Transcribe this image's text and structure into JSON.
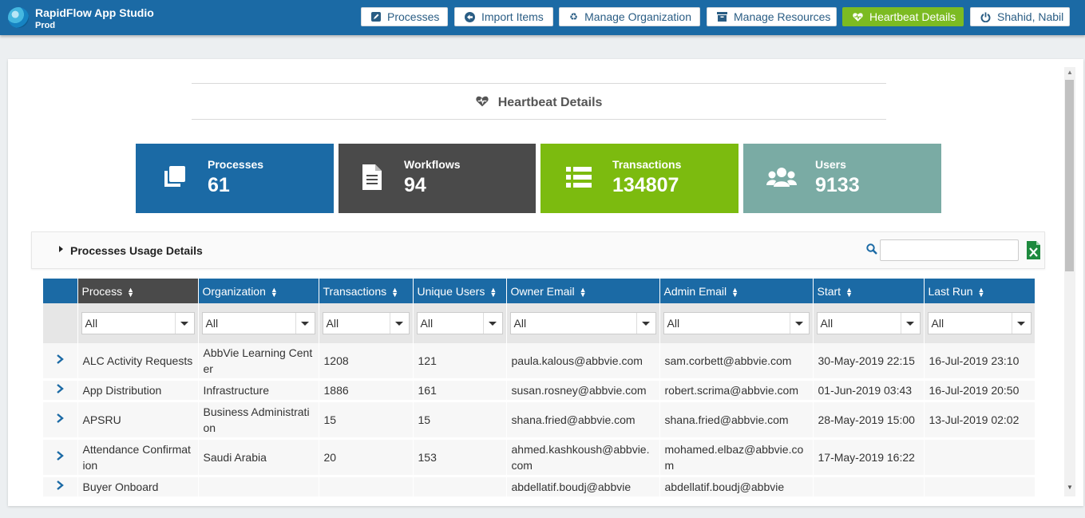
{
  "app": {
    "title": "RapidFlow App Studio",
    "env": "Prod"
  },
  "nav": [
    {
      "label": "Processes",
      "icon": "edit-square-icon"
    },
    {
      "label": "Import Items",
      "icon": "arrow-circle-left-icon"
    },
    {
      "label": "Manage Organization",
      "icon": "recycle-icon"
    },
    {
      "label": "Manage Resources",
      "icon": "archive-box-icon"
    },
    {
      "label": "Heartbeat Details",
      "icon": "heartbeat-icon",
      "active": true
    },
    {
      "label": "Shahid, Nabil",
      "icon": "power-icon"
    }
  ],
  "page": {
    "title": "Heartbeat Details"
  },
  "stats": [
    {
      "label": "Processes",
      "value": "61",
      "icon": "copy-icon",
      "color": "#1b6aa5"
    },
    {
      "label": "Workflows",
      "value": "94",
      "icon": "document-icon",
      "color": "#4a4a4a"
    },
    {
      "label": "Transactions",
      "value": "134807",
      "icon": "list-icon",
      "color": "#7cbb0f"
    },
    {
      "label": "Users",
      "value": "9133",
      "icon": "users-icon",
      "color": "#7aaba4"
    }
  ],
  "usage": {
    "title": "Processes Usage Details",
    "search_placeholder": ""
  },
  "table": {
    "columns": [
      "Process",
      "Organization",
      "Transactions",
      "Unique Users",
      "Owner Email",
      "Admin Email",
      "Start",
      "Last Run"
    ],
    "filter_value": "All",
    "rows": [
      [
        "ALC Activity Requests",
        "AbbVie Learning Center",
        "1208",
        "121",
        "paula.kalous@abbvie.com",
        "sam.corbett@abbvie.com",
        "30-May-2019 22:15",
        "16-Jul-2019 23:10"
      ],
      [
        "App Distribution",
        "Infrastructure",
        "1886",
        "161",
        "susan.rosney@abbvie.com",
        "robert.scrima@abbvie.com",
        "01-Jun-2019 03:43",
        "16-Jul-2019 20:50"
      ],
      [
        "APSRU",
        "Business Administration",
        "15",
        "15",
        "shana.fried@abbvie.com",
        "shana.fried@abbvie.com",
        "28-May-2019 15:00",
        "13-Jul-2019 02:02"
      ],
      [
        "Attendance Confirmation",
        "Saudi Arabia",
        "20",
        "153",
        "ahmed.kashkoush@abbvie.com",
        "mohamed.elbaz@abbvie.com",
        "17-May-2019 16:22",
        ""
      ],
      [
        "Buyer Onboard",
        "",
        "",
        "",
        "abdellatif.boudj@abbvie",
        "abdellatif.boudj@abbvie",
        "",
        ""
      ]
    ]
  }
}
